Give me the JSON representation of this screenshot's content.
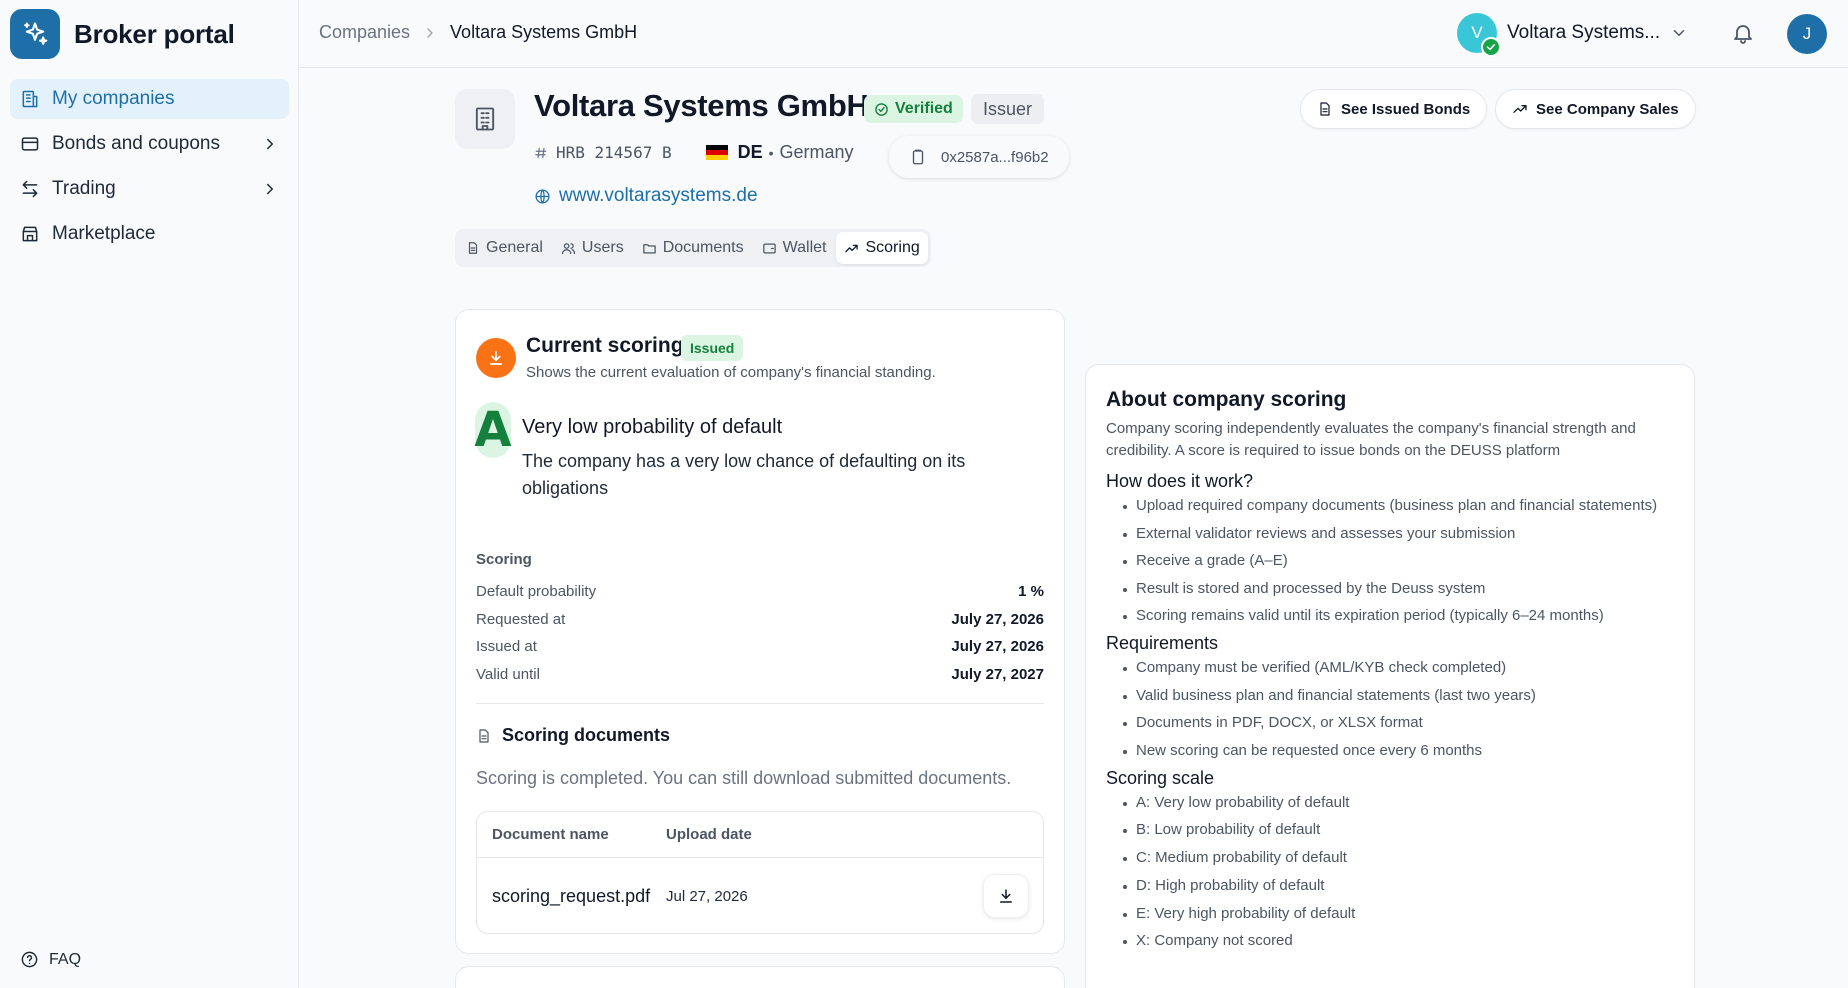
{
  "brand": {
    "title": "Broker portal"
  },
  "nav": [
    {
      "label": "My companies",
      "icon": "building-icon",
      "active": true
    },
    {
      "label": "Bonds and coupons",
      "icon": "card-icon",
      "has_children": true
    },
    {
      "label": "Trading",
      "icon": "arrows-icon",
      "has_children": true
    },
    {
      "label": "Marketplace",
      "icon": "store-icon"
    }
  ],
  "faq": {
    "label": "FAQ"
  },
  "breadcrumb": {
    "root": "Companies",
    "current": "Voltara Systems GmbH"
  },
  "company_switcher": {
    "initial": "V",
    "name": "Voltara Systems..."
  },
  "user": {
    "initial": "J"
  },
  "company": {
    "name": "Voltara Systems GmbH",
    "verified_label": "Verified",
    "role_label": "Issuer",
    "hrb": "HRB 214567 B",
    "flag": "🇩🇪",
    "country_code": "DE",
    "country_name": "Germany",
    "wallet": "0x2587a...f96b2",
    "website": "www.voltarasystems.de"
  },
  "actions": {
    "issued_bonds": "See Issued Bonds",
    "company_sales": "See Company Sales"
  },
  "tabs": [
    {
      "label": "General",
      "icon": "document-icon"
    },
    {
      "label": "Users",
      "icon": "users-icon"
    },
    {
      "label": "Documents",
      "icon": "folder-icon"
    },
    {
      "label": "Wallet",
      "icon": "wallet-icon"
    },
    {
      "label": "Scoring",
      "icon": "trend-icon",
      "active": true
    }
  ],
  "scoring": {
    "title": "Current scoring",
    "status": "Issued",
    "subtitle": "Shows the current evaluation of company's financial standing.",
    "grade": "A",
    "grade_title": "Very low probability of default",
    "grade_desc": "The company has a very low chance of defaulting on its obligations",
    "section_label": "Scoring",
    "rows": [
      {
        "label": "Default probability",
        "value": "1 %"
      },
      {
        "label": "Requested at",
        "value": "July 27, 2026"
      },
      {
        "label": "Issued at",
        "value": "July 27, 2026"
      },
      {
        "label": "Valid until",
        "value": "July 27, 2027"
      }
    ],
    "docs_title": "Scoring documents",
    "docs_note": "Scoring is completed. You can still download submitted documents.",
    "table_headers": {
      "name": "Document name",
      "date": "Upload date"
    },
    "documents": [
      {
        "name": "scoring_request.pdf",
        "date": "Jul 27, 2026"
      }
    ]
  },
  "about": {
    "title": "About company scoring",
    "intro": "Company scoring independently evaluates the company's financial strength and credibility. A score is required to issue bonds on the DEUSS platform",
    "how_title": "How does it work?",
    "how": [
      "Upload required company documents (business plan and financial statements)",
      "External validator reviews and assesses your submission",
      "Receive a grade (A–E)",
      "Result is stored and processed by the Deuss system",
      "Scoring remains valid until its expiration period (typically 6–24 months)"
    ],
    "req_title": "Requirements",
    "requirements": [
      "Company must be verified (AML/KYB check completed)",
      "Valid business plan and financial statements (last two years)",
      "Documents in PDF, DOCX, or XLSX format",
      "New scoring can be requested once every 6 months"
    ],
    "scale_title": "Scoring scale",
    "scale": [
      "A: Very low probability of default",
      "B: Low probability of default",
      "C: Medium probability of default",
      "D: High probability of default",
      "E: Very high probability of default",
      "X: Company not scored"
    ]
  }
}
